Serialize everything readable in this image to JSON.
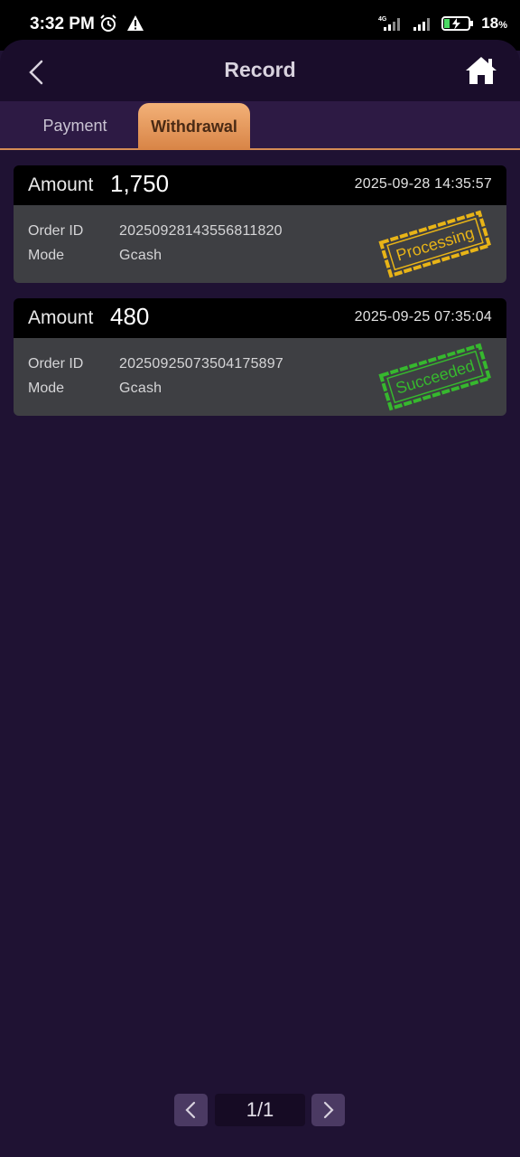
{
  "status_bar": {
    "time": "3:32 PM",
    "network": "4G",
    "battery": "18",
    "battery_unit": "%"
  },
  "header": {
    "title": "Record",
    "back_icon": "chevron-left-icon",
    "home_icon": "home-icon"
  },
  "tabs": [
    {
      "label": "Payment",
      "active": false
    },
    {
      "label": "Withdrawal",
      "active": true
    }
  ],
  "records": [
    {
      "amount_label": "Amount",
      "amount": "1,750",
      "time": "2025-09-28 14:35:57",
      "order_id_label": "Order ID",
      "order_id": "20250928143556811820",
      "mode_label": "Mode",
      "mode": "Gcash",
      "status": "Processing",
      "status_color": "#e8b417"
    },
    {
      "amount_label": "Amount",
      "amount": "480",
      "time": "2025-09-25 07:35:04",
      "order_id_label": "Order ID",
      "order_id": "20250925073504175897",
      "mode_label": "Mode",
      "mode": "Gcash",
      "status": "Succeeded",
      "status_color": "#36b82e"
    }
  ],
  "pager": {
    "text": "1/1"
  },
  "colors": {
    "background": "#1f1233",
    "tab_active": "#e89a5c",
    "tab_underline": "#d58b55",
    "card_body": "#3e3f43"
  }
}
